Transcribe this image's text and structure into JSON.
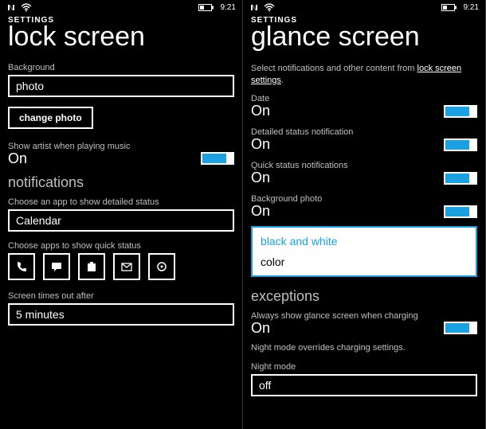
{
  "status": {
    "time": "9:21"
  },
  "left": {
    "settings_header": "SETTINGS",
    "title": "lock screen",
    "background_label": "Background",
    "background_value": "photo",
    "change_photo": "change photo",
    "artist_toggle": {
      "label": "Show artist when playing music",
      "value": "On"
    },
    "notifications_header": "notifications",
    "detailed_label": "Choose an app to show detailed status",
    "detailed_value": "Calendar",
    "quick_label": "Choose apps to show quick status",
    "quick_icons": [
      "phone-icon",
      "message-icon",
      "store-icon",
      "email-icon",
      "app-icon"
    ],
    "timeout_label": "Screen times out after",
    "timeout_value": "5 minutes"
  },
  "right": {
    "settings_header": "SETTINGS",
    "title": "glance screen",
    "intro_text": "Select notifications and other content from ",
    "intro_link": "lock screen settings",
    "toggles": {
      "date": {
        "label": "Date",
        "value": "On"
      },
      "detailed": {
        "label": "Detailed status notification",
        "value": "On"
      },
      "quick": {
        "label": "Quick status notifications",
        "value": "On"
      },
      "photo": {
        "label": "Background photo",
        "value": "On"
      }
    },
    "photo_options": {
      "selected": "black and white",
      "other": "color"
    },
    "exceptions_header": "exceptions",
    "charging_toggle": {
      "label": "Always show glance screen when charging",
      "value": "On"
    },
    "charging_note": "Night mode overrides charging settings.",
    "night_label": "Night mode",
    "night_value": "off"
  }
}
